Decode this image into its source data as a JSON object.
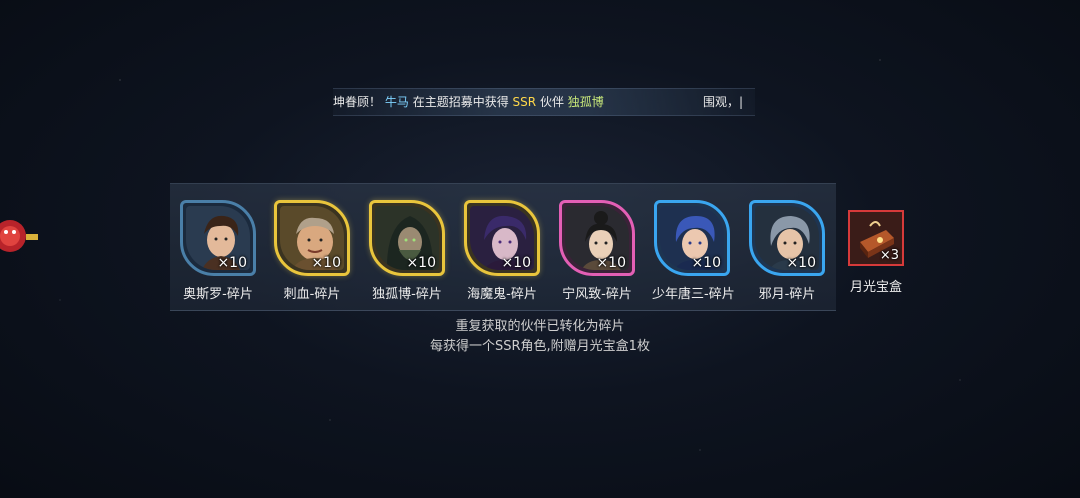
{
  "marquee": {
    "text_prefix": "坤眷顾！",
    "player": "牛马",
    "middle": "在主题招募中获得",
    "rarity": "SSR",
    "partner_word": "伙伴",
    "partner": "独孤博",
    "tail": "围观，|"
  },
  "rewards": [
    {
      "name": "奥斯罗-碎片",
      "count": "×10",
      "frame": "teal",
      "icon": "portrait-osiro"
    },
    {
      "name": "刺血-碎片",
      "count": "×10",
      "frame": "gold",
      "icon": "portrait-cixue"
    },
    {
      "name": "独孤博-碎片",
      "count": "×10",
      "frame": "gold",
      "icon": "portrait-dugubo"
    },
    {
      "name": "海魔鬼-碎片",
      "count": "×10",
      "frame": "gold",
      "icon": "portrait-haimogui"
    },
    {
      "name": "宁风致-碎片",
      "count": "×10",
      "frame": "pink",
      "icon": "portrait-ningfengzhi"
    },
    {
      "name": "少年唐三-碎片",
      "count": "×10",
      "frame": "cyan",
      "icon": "portrait-tangsan"
    },
    {
      "name": "邪月-碎片",
      "count": "×10",
      "frame": "cyan",
      "icon": "portrait-xieyue"
    },
    {
      "name": "月光宝盒",
      "count": "×3",
      "frame": "red",
      "icon": "moonlight-box"
    }
  ],
  "info": {
    "line1": "重复获取的伙伴已转化为碎片",
    "line2": "每获得一个SSR角色,附赠月光宝盒1枚"
  },
  "colors": {
    "blue_frame": "#3c8fd6",
    "gold_frame": "#e9c53c",
    "pink_frame": "#e35fb5",
    "red_frame": "#d63a3a",
    "player_name": "#7fd3ff",
    "ssr_text": "#ffd84a"
  }
}
